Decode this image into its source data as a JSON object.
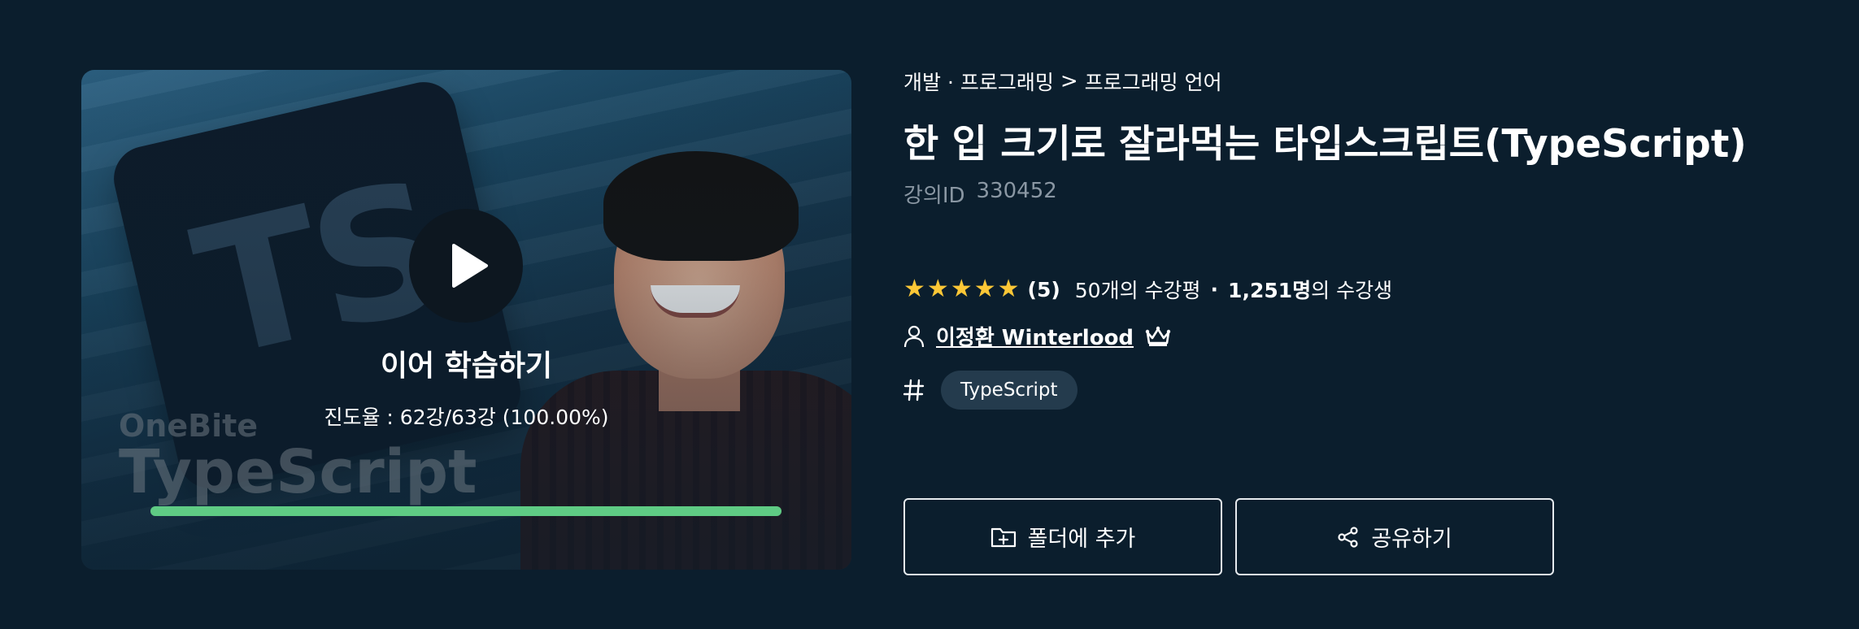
{
  "video": {
    "logo_text": "TS",
    "watermark_line1": "OneBite",
    "watermark_line2": "TypeScript",
    "resume_label": "이어 학습하기",
    "progress_text": "진도율 : 62강/63강 (100.00%)",
    "progress_percent": 100,
    "progress_color": "#5fcb84"
  },
  "breadcrumb": {
    "category": "개발 · 프로그래밍",
    "separator": ">",
    "subcategory": "프로그래밍 언어"
  },
  "course": {
    "title": "한 입 크기로 잘라먹는 타입스크립트(TypeScript)",
    "id_label": "강의ID",
    "id_value": "330452"
  },
  "rating": {
    "stars": 5,
    "score": "(5)",
    "review_count": "50개의 수강평",
    "dot": "·",
    "student_count": "1,251명",
    "student_suffix": "의 수강생",
    "star_color": "#fcc736"
  },
  "instructor": {
    "name": "이정환 Winterlood"
  },
  "tags": [
    "TypeScript"
  ],
  "actions": {
    "folder_label": "폴더에 추가",
    "share_label": "공유하기"
  }
}
